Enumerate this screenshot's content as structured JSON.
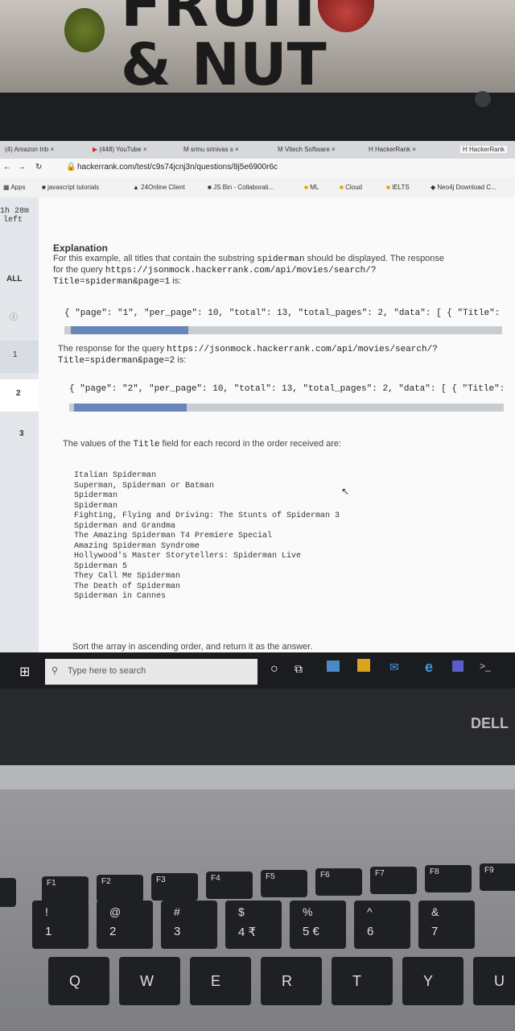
{
  "browser": {
    "tabs": [
      "(4) Amazon Inb",
      "(448) YouTube",
      "srinu srinivas s",
      "Vitech Software",
      "HackerRank",
      "HackerRank"
    ],
    "url": "hackerrank.com/test/c9s74jcnj3n/questions/8j5e6900r6c",
    "bookmarks": [
      "Apps",
      "javascript tutorials",
      "24Online Client",
      "JS Bin - Collaborati...",
      "ML",
      "Cloud",
      "IELTS",
      "Neo4j Download C..."
    ]
  },
  "sidebar": {
    "timer": "1h 28m",
    "timer_sub": "left",
    "items": [
      "ALL",
      "1",
      "2",
      "3"
    ]
  },
  "problem": {
    "heading": "Explanation",
    "para1_a": "For this example, all titles that contain the substring",
    "para1_b": "spiderman",
    "para1_c": "should be displayed. The response",
    "para1_d": "for the query",
    "para1_e": "https://jsonmock.hackerrank.com/api/movies/search/?",
    "para1_f": "Title=spiderman&page=1",
    "para1_g": "is:",
    "json1": "{ \"page\": \"1\", \"per_page\": 10, \"total\": 13, \"total_pages\": 2, \"data\": [ { \"Title\":",
    "para2_a": "The response for the query",
    "para2_b": "https://jsonmock.hackerrank.com/api/movies/search/?",
    "para2_c": "Title=spiderman&page=2",
    "para2_d": "is:",
    "json2": "{ \"page\": \"2\", \"per_page\": 10, \"total\": 13, \"total_pages\": 2, \"data\": [ { \"Title\":",
    "para3_a": "The values of the",
    "para3_b": "Title",
    "para3_c": "field for each record in the order received are:",
    "titles": [
      "Italian Spiderman",
      "Superman, Spiderman or Batman",
      "Spiderman",
      "Spiderman",
      "Fighting, Flying and Driving: The Stunts of Spiderman 3",
      "Spiderman and Grandma",
      "The Amazing Spiderman T4 Premiere Special",
      "Amazing Spiderman Syndrome",
      "Hollywood's Master Storytellers: Spiderman Live",
      "Spiderman 5",
      "They Call Me Spiderman",
      "The Death of Spiderman",
      "Spiderman in Cannes"
    ],
    "instruction": "Sort the array in ascending order, and return it as the answer."
  },
  "taskbar": {
    "search_placeholder": "Type here to search"
  },
  "laptop": {
    "brand": "DELL"
  },
  "poster": {
    "line1": "FRUIT",
    "line2": "& NUT"
  },
  "keyboard": {
    "fn_keys": [
      "F1",
      "F2",
      "F3",
      "F4",
      "F5",
      "F6",
      "F7",
      "F8",
      "F9"
    ],
    "num_keys": [
      {
        "top": "!",
        "bottom": "1"
      },
      {
        "top": "@",
        "bottom": "2"
      },
      {
        "top": "#",
        "bottom": "3"
      },
      {
        "top": "$",
        "bottom": "4 ₹"
      },
      {
        "top": "%",
        "bottom": "5 €"
      },
      {
        "top": "^",
        "bottom": "6"
      },
      {
        "top": "&",
        "bottom": "7"
      }
    ],
    "letter_keys": [
      "Q",
      "W",
      "E",
      "R",
      "T",
      "Y",
      "U"
    ]
  }
}
